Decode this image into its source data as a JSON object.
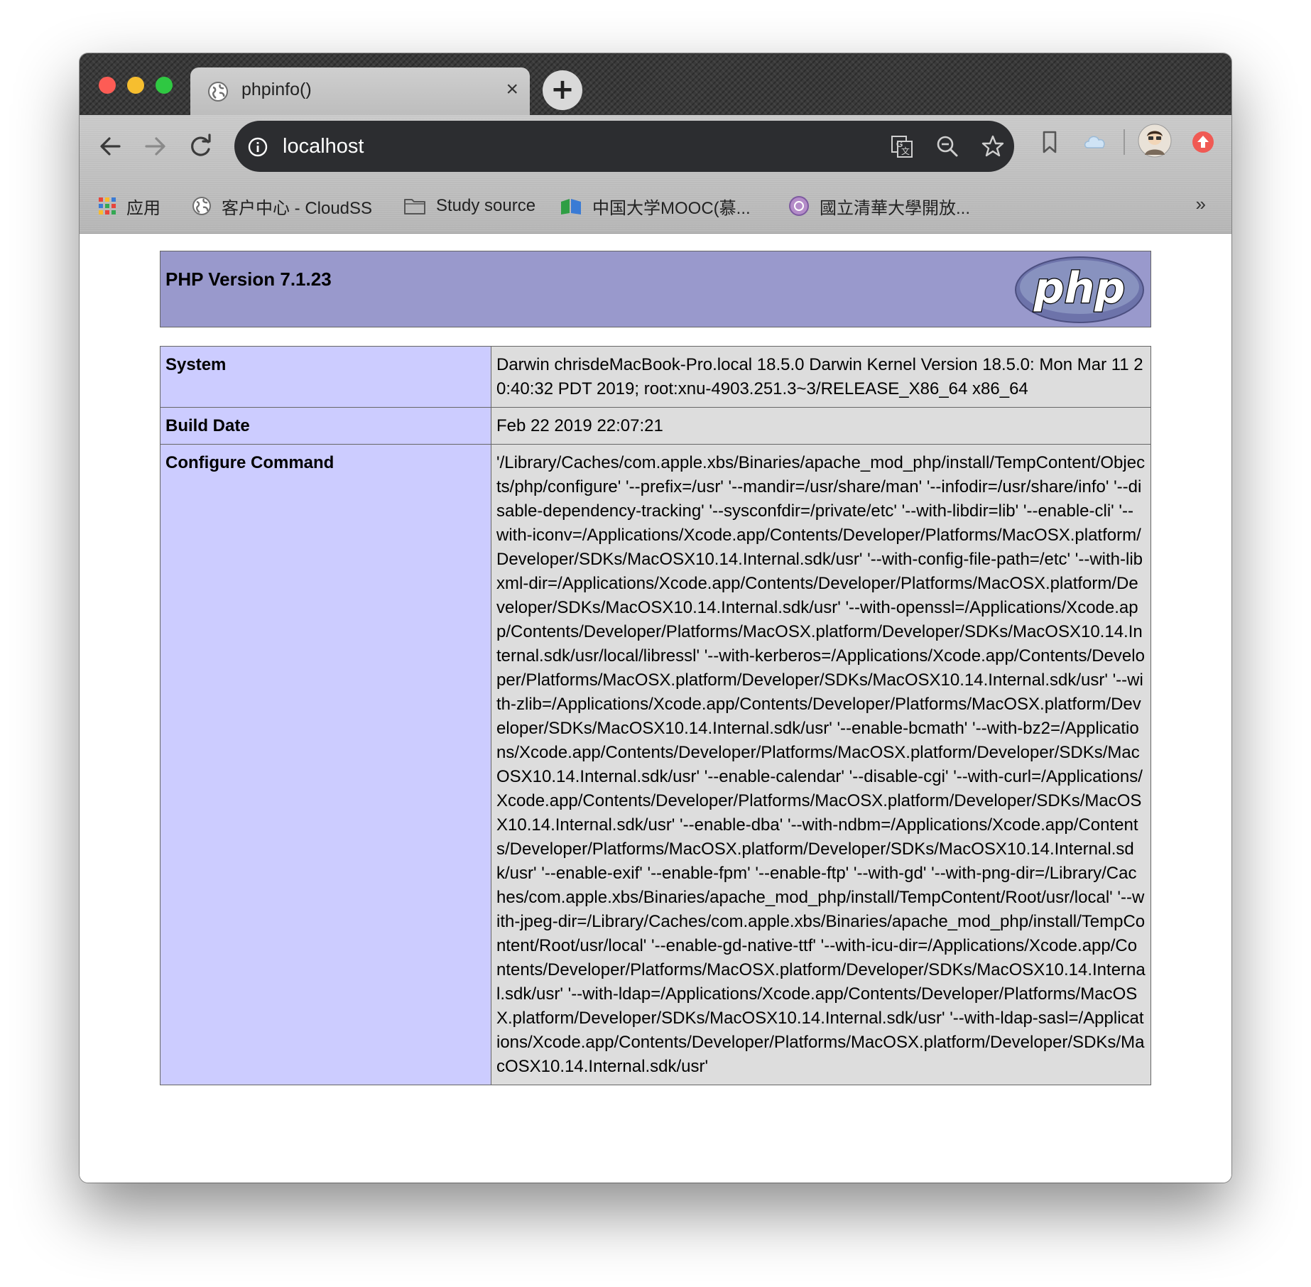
{
  "browser": {
    "tab": {
      "title": "phpinfo()",
      "close_label": "×"
    },
    "new_tab_label": "+",
    "address": {
      "url": "localhost"
    },
    "bookmarks": [
      {
        "label": "应用",
        "icon": "apps-grid-icon"
      },
      {
        "label": "客户中心 - CloudSS",
        "icon": "globe-icon"
      },
      {
        "label": "Study source",
        "icon": "folder-icon"
      },
      {
        "label": "中国大学MOOC(慕...",
        "icon": "mooc-icon"
      },
      {
        "label": "國立清華大學開放...",
        "icon": "nthu-icon"
      }
    ],
    "bookmarks_overflow": "»"
  },
  "phpinfo": {
    "version_title": "PHP Version 7.1.23",
    "logo_text": "php",
    "rows": [
      {
        "key": "System",
        "value": "Darwin chrisdeMacBook-Pro.local 18.5.0 Darwin Kernel Version 18.5.0: Mon Mar 11 20:40:32 PDT 2019; root:xnu-4903.251.3~3/RELEASE_X86_64 x86_64"
      },
      {
        "key": "Build Date",
        "value": "Feb 22 2019 22:07:21"
      },
      {
        "key": "Configure Command",
        "value": "'/Library/Caches/com.apple.xbs/Binaries/apache_mod_php/install/TempContent/Objects/php/configure' '--prefix=/usr' '--mandir=/usr/share/man' '--infodir=/usr/share/info' '--disable-dependency-tracking' '--sysconfdir=/private/etc' '--with-libdir=lib' '--enable-cli' '--with-iconv=/Applications/Xcode.app/Contents/Developer/Platforms/MacOSX.platform/Developer/SDKs/MacOSX10.14.Internal.sdk/usr' '--with-config-file-path=/etc' '--with-libxml-dir=/Applications/Xcode.app/Contents/Developer/Platforms/MacOSX.platform/Developer/SDKs/MacOSX10.14.Internal.sdk/usr' '--with-openssl=/Applications/Xcode.app/Contents/Developer/Platforms/MacOSX.platform/Developer/SDKs/MacOSX10.14.Internal.sdk/usr/local/libressl' '--with-kerberos=/Applications/Xcode.app/Contents/Developer/Platforms/MacOSX.platform/Developer/SDKs/MacOSX10.14.Internal.sdk/usr' '--with-zlib=/Applications/Xcode.app/Contents/Developer/Platforms/MacOSX.platform/Developer/SDKs/MacOSX10.14.Internal.sdk/usr' '--enable-bcmath' '--with-bz2=/Applications/Xcode.app/Contents/Developer/Platforms/MacOSX.platform/Developer/SDKs/MacOSX10.14.Internal.sdk/usr' '--enable-calendar' '--disable-cgi' '--with-curl=/Applications/Xcode.app/Contents/Developer/Platforms/MacOSX.platform/Developer/SDKs/MacOSX10.14.Internal.sdk/usr' '--enable-dba' '--with-ndbm=/Applications/Xcode.app/Contents/Developer/Platforms/MacOSX.platform/Developer/SDKs/MacOSX10.14.Internal.sdk/usr' '--enable-exif' '--enable-fpm' '--enable-ftp' '--with-gd' '--with-png-dir=/Library/Caches/com.apple.xbs/Binaries/apache_mod_php/install/TempContent/Root/usr/local' '--with-jpeg-dir=/Library/Caches/com.apple.xbs/Binaries/apache_mod_php/install/TempContent/Root/usr/local' '--enable-gd-native-ttf' '--with-icu-dir=/Applications/Xcode.app/Contents/Developer/Platforms/MacOSX.platform/Developer/SDKs/MacOSX10.14.Internal.sdk/usr' '--with-ldap=/Applications/Xcode.app/Contents/Developer/Platforms/MacOSX.platform/Developer/SDKs/MacOSX10.14.Internal.sdk/usr' '--with-ldap-sasl=/Applications/Xcode.app/Contents/Developer/Platforms/MacOSX.platform/Developer/SDKs/MacOSX10.14.Internal.sdk/usr'"
      }
    ]
  },
  "colors": {
    "header_bg": "#9999cc",
    "key_bg": "#ccccff",
    "value_bg": "#dddddd",
    "border": "#666666"
  }
}
